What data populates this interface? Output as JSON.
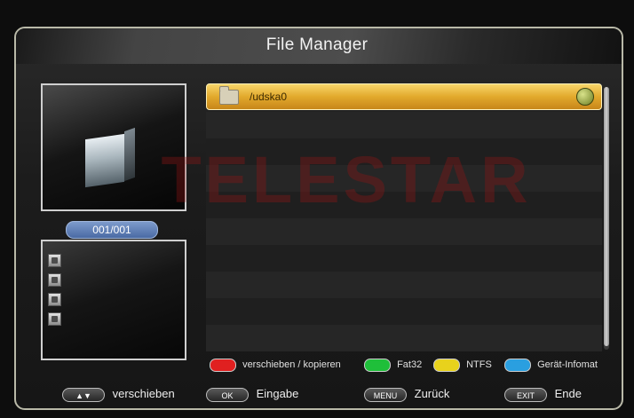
{
  "header": {
    "title": "File Manager"
  },
  "watermark": "TELESTAR",
  "preview": {
    "counter": "001/001"
  },
  "tools": {
    "icons": [
      "photo-icon",
      "contact-icon",
      "monitor-icon",
      "network-icon"
    ]
  },
  "file_list": {
    "items": [
      {
        "label": "/udska0",
        "icon": "folder-icon",
        "status_icon": "usb-icon",
        "selected": true
      }
    ]
  },
  "legend": {
    "red": {
      "label": "verschieben / kopieren",
      "color": "#e02020"
    },
    "green": {
      "label": "Fat32",
      "color": "#1fbf3a"
    },
    "yellow": {
      "label": "NTFS",
      "color": "#e8d21c"
    },
    "blue": {
      "label": "Gerät-Infomat",
      "color": "#2a9fe0"
    }
  },
  "footer": {
    "move": {
      "key": "▲▼",
      "label": "verschieben"
    },
    "ok": {
      "key": "OK",
      "label": "Eingabe"
    },
    "menu": {
      "key": "MENU",
      "label": "Zurück"
    },
    "exit": {
      "key": "EXIT",
      "label": "Ende"
    }
  }
}
